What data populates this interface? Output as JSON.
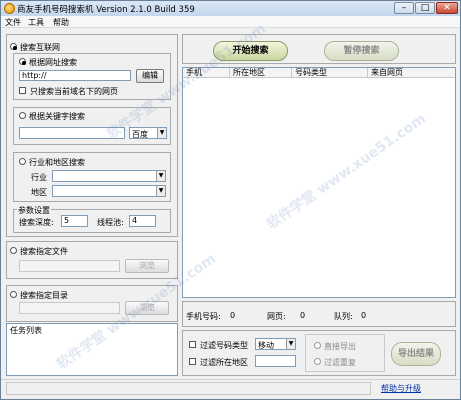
{
  "window": {
    "title": "商友手机号码搜索机 Version 2.1.0 Build 359",
    "controls": {
      "minimize": "–",
      "maximize": "□",
      "close": "✕"
    }
  },
  "menu": [
    "文件",
    "工具",
    "帮助"
  ],
  "left": {
    "internet_group": {
      "label": "搜索互联网",
      "by_url": {
        "label": "根据网址搜索",
        "url_value": "http://",
        "edit_button": "编辑",
        "only_current_domain": "只搜索当前域名下的网页"
      },
      "by_keyword": {
        "label": "根据关键字搜索",
        "keyword_value": "",
        "engine": "百度"
      },
      "by_industry": {
        "label": "行业和地区搜索",
        "industry_label": "行业",
        "region_label": "地区"
      },
      "params": {
        "title": "参数设置",
        "depth_label": "搜索深度:",
        "depth_value": "5",
        "threads_label": "线程池:",
        "threads_value": "4"
      }
    },
    "file_group": {
      "label": "搜索指定文件",
      "browse": "浏览"
    },
    "dir_group": {
      "label": "搜索指定目录",
      "browse": "浏览"
    },
    "task_list": {
      "label": "任务列表"
    }
  },
  "right": {
    "start_button": "开始搜索",
    "pause_button": "暂停搜索",
    "table": {
      "columns": [
        "手机",
        "所在地区",
        "号码类型",
        "来自网页"
      ]
    },
    "stats": {
      "phone_label": "手机号码:",
      "phone_value": "0",
      "pages_label": "网页:",
      "pages_value": "0",
      "queue_label": "队列:",
      "queue_value": "0"
    },
    "filters": {
      "type_label": "过滤号码类型",
      "type_value": "移动",
      "region_label": "过滤所在地区",
      "region_value": ""
    },
    "export": {
      "direct_label": "直接导出",
      "dedupe_label": "过滤重复",
      "button": "导出结果"
    }
  },
  "statusbar": {
    "help_link": "帮助与升级"
  },
  "watermark": "软件学堂 www.xue51.com"
}
